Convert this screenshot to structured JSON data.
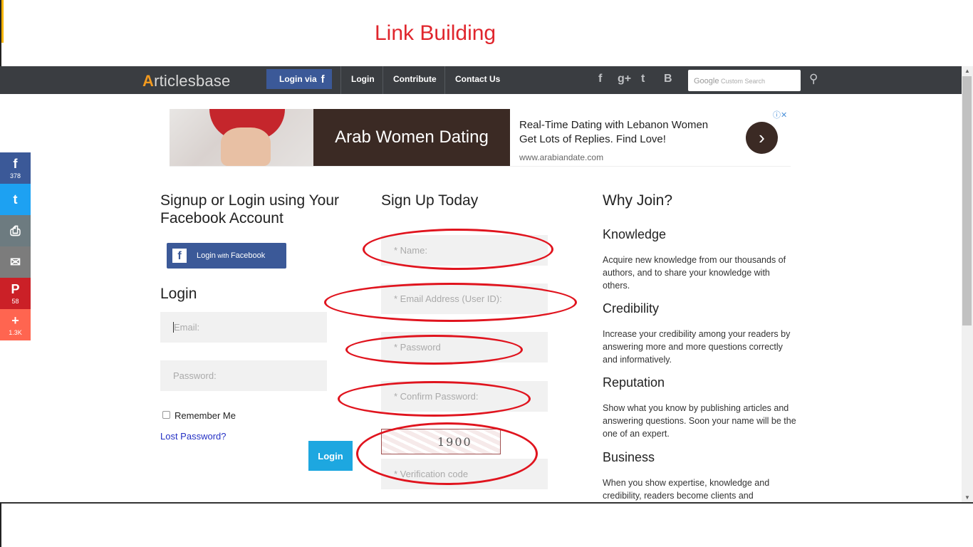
{
  "caption": {
    "title": "Link Building"
  },
  "navbar": {
    "logo": {
      "first": "A",
      "rest": "rticlesbase"
    },
    "fb_login": {
      "label": "Login via",
      "icon": "f"
    },
    "links": [
      "Login",
      "Contribute",
      "Contact Us"
    ],
    "social_icons": [
      "facebook-icon",
      "google-plus-icon",
      "twitter-icon",
      "blogger-icon"
    ],
    "social_glyphs": [
      "f",
      "g+",
      "t",
      "B"
    ],
    "search": {
      "brand": "Google",
      "placeholder": "Custom Search"
    }
  },
  "ad": {
    "banner": "Arab Women Dating",
    "line1": "Real-Time Dating with Lebanon Women",
    "line2": "Get Lots of Replies. Find Love!",
    "url": "www.arabiandate.com",
    "arrow": "›",
    "info": "ⓘ✕"
  },
  "share_bar": [
    {
      "name": "facebook",
      "glyph": "f",
      "count": "378",
      "color": "#3b5998"
    },
    {
      "name": "twitter",
      "glyph": "t",
      "count": "",
      "color": "#1da1f2"
    },
    {
      "name": "print",
      "glyph": "⎙",
      "count": "",
      "color": "#6d7b80"
    },
    {
      "name": "email",
      "glyph": "✉",
      "count": "",
      "color": "#7c7c7c"
    },
    {
      "name": "pinterest",
      "glyph": "P",
      "count": "58",
      "color": "#cb2027"
    },
    {
      "name": "more",
      "glyph": "+",
      "count": "1.3K",
      "color": "#ff6550"
    }
  ],
  "facebook_section": {
    "title_line1": "Signup or Login using Your",
    "title_line2": "Facebook Account",
    "button": {
      "icon": "f",
      "label_pre": "Login",
      "label_mid": " with ",
      "label_post": "Facebook"
    }
  },
  "login": {
    "title": "Login",
    "email_placeholder": "Email:",
    "password_placeholder": "Password:",
    "remember": "Remember Me",
    "lost_password": "Lost Password?",
    "submit": "Login"
  },
  "signup": {
    "title": "Sign Up Today",
    "name_placeholder": "* Name:",
    "email_placeholder": "* Email Address (User ID):",
    "password_placeholder": "* Password",
    "confirm_placeholder": "* Confirm Password:",
    "captcha_text": "1900",
    "verification_placeholder": "* Verification code"
  },
  "why_join": {
    "title": "Why Join?",
    "items": [
      {
        "heading": "Knowledge",
        "text": "Acquire new knowledge from our thousands of authors, and to share your knowledge with others."
      },
      {
        "heading": "Credibility",
        "text": "Increase your credibility among your readers by answering more and more questions correctly and informatively."
      },
      {
        "heading": "Reputation",
        "text": "Show what you know by publishing articles and answering questions. Soon your name will be the one of an expert."
      },
      {
        "heading": "Business",
        "text": "When you show expertise, knowledge and credibility, readers become clients and"
      }
    ]
  },
  "colors": {
    "annotation": "#e0141e",
    "nav_bg": "#3a3d41",
    "facebook": "#3b5998",
    "login_button": "#1da7e0"
  }
}
